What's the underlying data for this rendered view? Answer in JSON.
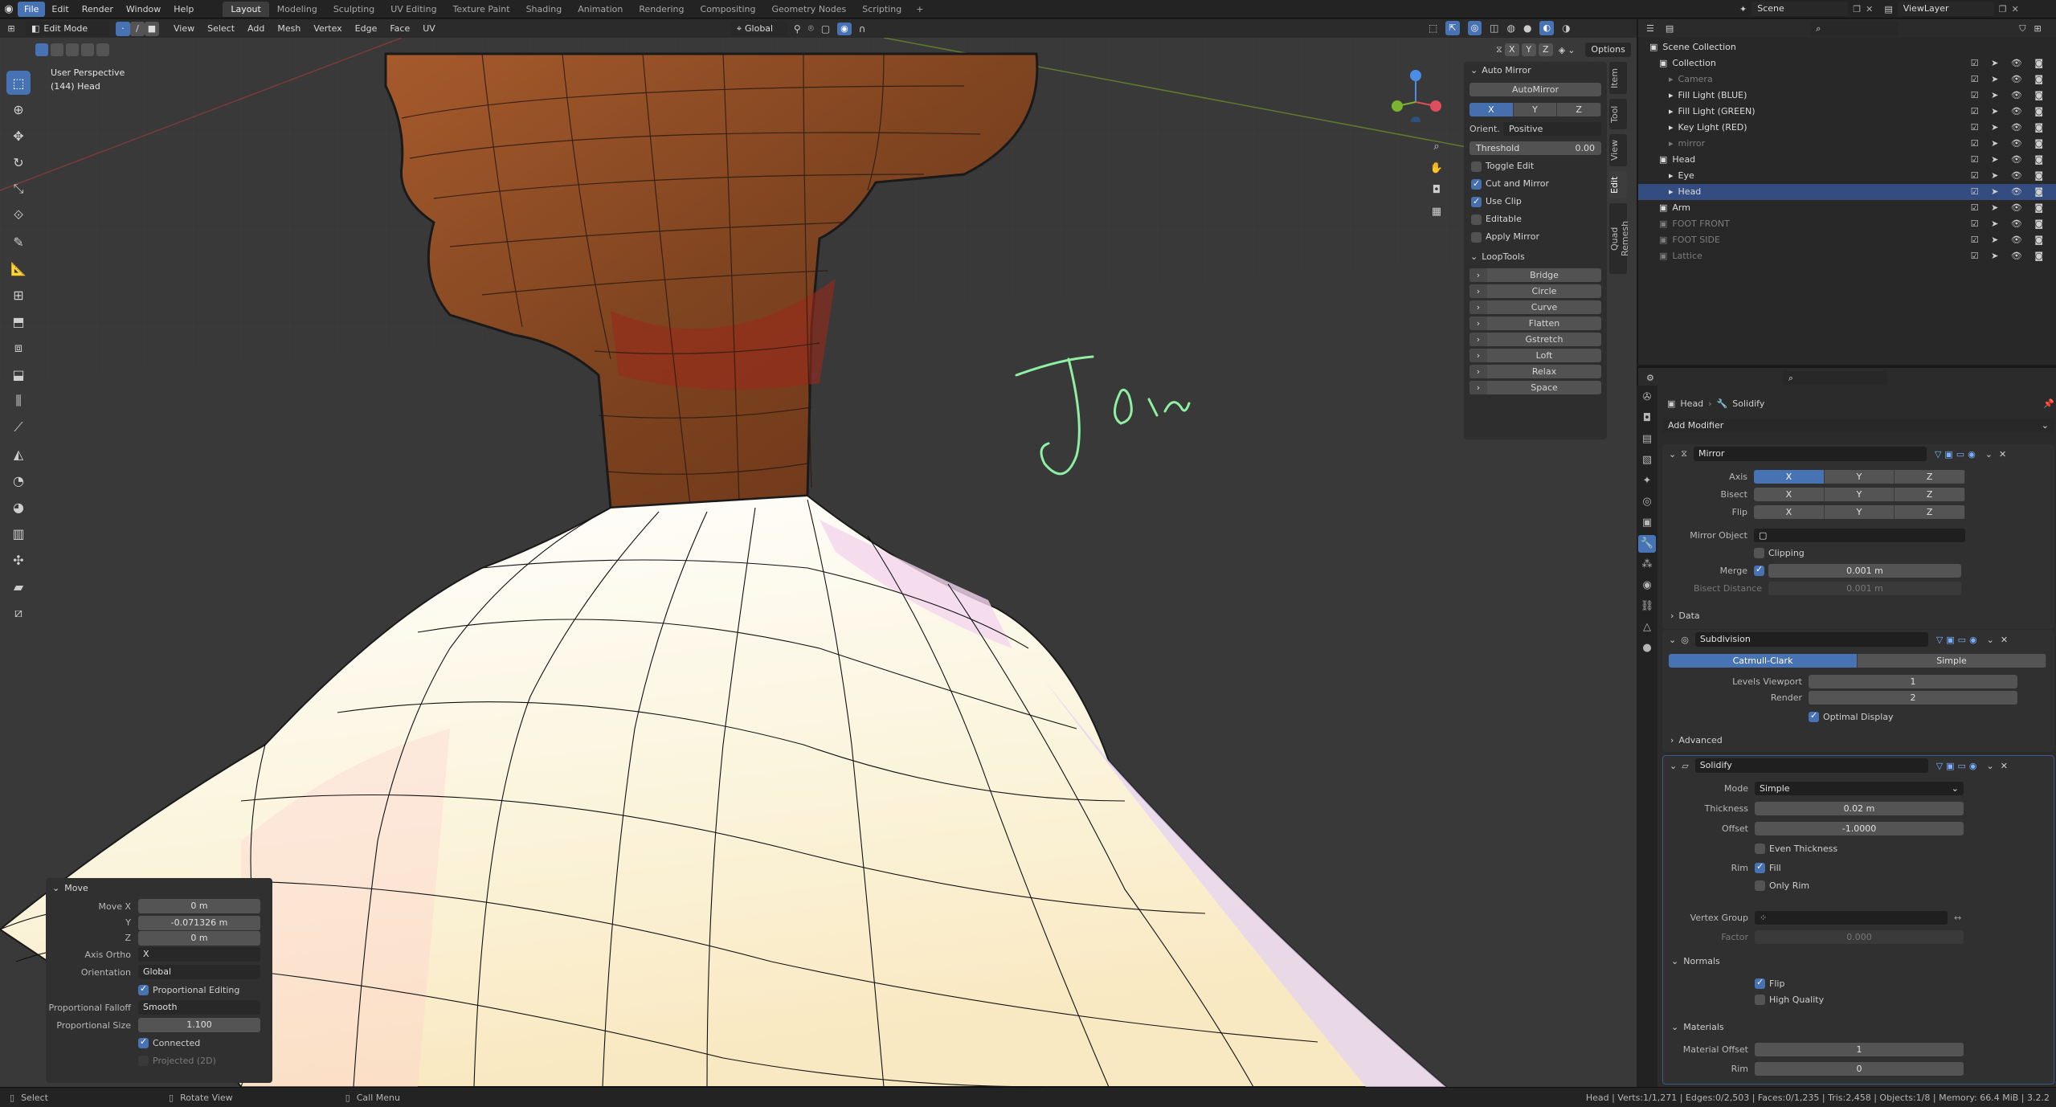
{
  "top_menu": [
    "File",
    "Edit",
    "Render",
    "Window",
    "Help"
  ],
  "workspaces": [
    "Layout",
    "Modeling",
    "Sculpting",
    "UV Editing",
    "Texture Paint",
    "Shading",
    "Animation",
    "Rendering",
    "Compositing",
    "Geometry Nodes",
    "Scripting"
  ],
  "scene": "Scene",
  "view_layer": "ViewLayer",
  "vp_header": {
    "mode": "Edit Mode",
    "menus": [
      "View",
      "Select",
      "Add",
      "Mesh",
      "Vertex",
      "Edge",
      "Face",
      "UV"
    ],
    "orientation": "Global",
    "options": "Options",
    "xyz": [
      "X",
      "Y",
      "Z"
    ]
  },
  "viewport": {
    "perspective": "User Perspective",
    "object": "(144) Head",
    "handwriting": "Join"
  },
  "npanel": {
    "automirror_title": "Auto Mirror",
    "automirror_btn": "AutoMirror",
    "axes": [
      "X",
      "Y",
      "Z"
    ],
    "orient_label": "Orient.",
    "orient_value": "Positive",
    "threshold_label": "Threshold",
    "threshold_value": "0.00",
    "checks": [
      {
        "label": "Toggle Edit",
        "on": false
      },
      {
        "label": "Cut and Mirror",
        "on": true
      },
      {
        "label": "Use Clip",
        "on": true
      },
      {
        "label": "Editable",
        "on": false
      },
      {
        "label": "Apply Mirror",
        "on": false
      }
    ],
    "looptools_title": "LoopTools",
    "looptools": [
      "Bridge",
      "Circle",
      "Curve",
      "Flatten",
      "Gstretch",
      "Loft",
      "Relax",
      "Space"
    ]
  },
  "vtabs": [
    "Item",
    "Tool",
    "View",
    "Edit",
    "Quad Remesh"
  ],
  "move_panel": {
    "title": "Move",
    "move_x_label": "Move X",
    "move_x": "0 m",
    "y_label": "Y",
    "y": "-0.071326 m",
    "z_label": "Z",
    "z": "0 m",
    "axis_ortho_label": "Axis Ortho",
    "axis_ortho": "X",
    "orientation_label": "Orientation",
    "orientation": "Global",
    "prop_edit": "Proportional Editing",
    "falloff_label": "Proportional Falloff",
    "falloff": "Smooth",
    "size_label": "Proportional Size",
    "size": "1.100",
    "connected": "Connected",
    "projected": "Projected (2D)"
  },
  "outliner": {
    "rows": [
      {
        "label": "Scene Collection",
        "indent": 0,
        "dim": false,
        "sel": false
      },
      {
        "label": "Collection",
        "indent": 1,
        "dim": false,
        "sel": false
      },
      {
        "label": "Camera",
        "indent": 2,
        "dim": true,
        "sel": false
      },
      {
        "label": "Fill Light (BLUE)",
        "indent": 2,
        "dim": false,
        "sel": false
      },
      {
        "label": "Fill Light (GREEN)",
        "indent": 2,
        "dim": false,
        "sel": false
      },
      {
        "label": "Key Light (RED)",
        "indent": 2,
        "dim": false,
        "sel": false
      },
      {
        "label": "mirror",
        "indent": 2,
        "dim": true,
        "sel": false
      },
      {
        "label": "Head",
        "indent": 1,
        "dim": false,
        "sel": false
      },
      {
        "label": "Eye",
        "indent": 2,
        "dim": false,
        "sel": false
      },
      {
        "label": "Head",
        "indent": 2,
        "dim": false,
        "sel": true
      },
      {
        "label": "Arm",
        "indent": 1,
        "dim": false,
        "sel": false
      },
      {
        "label": "FOOT FRONT",
        "indent": 1,
        "dim": true,
        "sel": false
      },
      {
        "label": "FOOT SIDE",
        "indent": 1,
        "dim": true,
        "sel": false
      },
      {
        "label": "Lattice",
        "indent": 1,
        "dim": true,
        "sel": false
      }
    ]
  },
  "props": {
    "breadcrumb_obj": "Head",
    "breadcrumb_mod": "Solidify",
    "add_modifier": "Add Modifier",
    "mirror": {
      "name": "Mirror",
      "axis_label": "Axis",
      "bisect_label": "Bisect",
      "flip_label": "Flip",
      "xyz": [
        "X",
        "Y",
        "Z"
      ],
      "mirror_object_label": "Mirror Object",
      "clipping": "Clipping",
      "merge_label": "Merge",
      "merge_value": "0.001 m",
      "bisect_distance_label": "Bisect Distance",
      "bisect_distance": "0.001 m",
      "data": "Data"
    },
    "subdivision": {
      "name": "Subdivision",
      "catmull": "Catmull-Clark",
      "simple": "Simple",
      "levels_viewport_label": "Levels Viewport",
      "levels_viewport": "1",
      "render_label": "Render",
      "render": "2",
      "optimal": "Optimal Display",
      "advanced": "Advanced"
    },
    "solidify": {
      "name": "Solidify",
      "mode_label": "Mode",
      "mode": "Simple",
      "thickness_label": "Thickness",
      "thickness": "0.02 m",
      "offset_label": "Offset",
      "offset": "-1.0000",
      "even": "Even Thickness",
      "rim_label": "Rim",
      "fill": "Fill",
      "only_rim": "Only Rim",
      "vgroup_label": "Vertex Group",
      "factor_label": "Factor",
      "factor": "0.000",
      "normals": "Normals",
      "flip": "Flip",
      "high_quality": "High Quality",
      "materials": "Materials",
      "mat_offset_label": "Material Offset",
      "mat_offset": "1",
      "rim2_label": "Rim",
      "rim2": "0"
    }
  },
  "status": {
    "select": "Select",
    "rotate": "Rotate View",
    "call_menu": "Call Menu",
    "stats": "Head | Verts:1/1,271 | Edges:0/2,503 | Faces:0/1,235 | Tris:2,458 | Objects:1/8 | Memory: 66.4 MiB | 3.2.2"
  },
  "colors": {
    "accent": "#4772b3",
    "skin": "#8a4a22",
    "shirt": "#fbf6ea",
    "handwriting": "#8ff0a4"
  }
}
